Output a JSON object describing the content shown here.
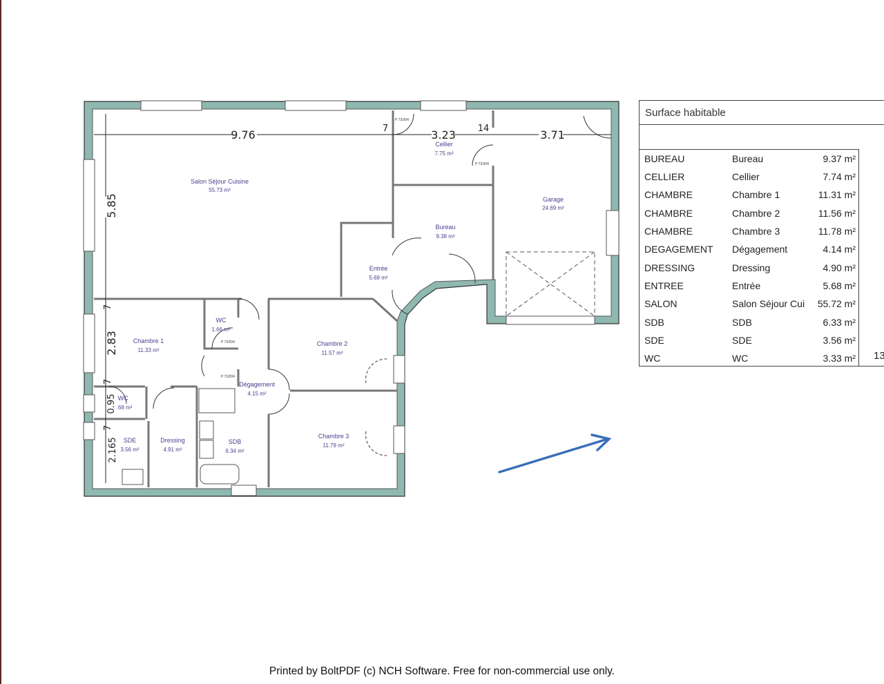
{
  "plan": {
    "rooms": [
      {
        "name": "Salon Séjour Cuisine",
        "area": "55.73 m²"
      },
      {
        "name": "Cellier",
        "area": "7.75 m²"
      },
      {
        "name": "Garage",
        "area": "24.69 m²"
      },
      {
        "name": "Bureau",
        "area": "9.38 m²"
      },
      {
        "name": "Entrée",
        "area": "5.69 m²"
      },
      {
        "name": "Chambre 1",
        "area": "11.33 m²"
      },
      {
        "name": "WC",
        "area": "1.66 m²"
      },
      {
        "name": "Chambre 2",
        "area": "11.57 m²"
      },
      {
        "name": "Dégagement",
        "area": "4.15 m²"
      },
      {
        "name": "Chambre 3",
        "area": "11.79 m²"
      },
      {
        "name": "WC",
        "area": ".68 m²"
      },
      {
        "name": "SDE",
        "area": "3.56 m²"
      },
      {
        "name": "Dressing",
        "area": "4.91 m²"
      },
      {
        "name": "SDB",
        "area": "6.34 m²"
      }
    ],
    "dimensions": {
      "salon_width": "9.76",
      "cellier_width": "3.23",
      "garage_width": "3.71",
      "wall_a": "7",
      "wall_b": "14",
      "salon_depth": "5.85",
      "chambre1_depth": "2.83",
      "wc_depth": "0.95",
      "sde_depth": "2.165",
      "wall_c": "7",
      "wall_d": "7",
      "wall_e": "7"
    },
    "door_ref": "P 73/204",
    "wall_color": "#8fb8b0",
    "label_color": "#4a3f8f",
    "arrow_color": "#3a6fb8"
  },
  "table": {
    "title": "Surface habitable",
    "rows": [
      {
        "category": "BUREAU",
        "room": "Bureau",
        "area": "9.37 m²"
      },
      {
        "category": "CELLIER",
        "room": "Cellier",
        "area": "7.74 m²"
      },
      {
        "category": "CHAMBRE",
        "room": "Chambre 1",
        "area": "11.31 m²"
      },
      {
        "category": "CHAMBRE",
        "room": "Chambre 2",
        "area": "11.56 m²"
      },
      {
        "category": "CHAMBRE",
        "room": "Chambre 3",
        "area": "11.78 m²"
      },
      {
        "category": "DEGAGEMENT",
        "room": "Dégagement",
        "area": "4.14 m²"
      },
      {
        "category": "DRESSING",
        "room": "Dressing",
        "area": "4.90 m²"
      },
      {
        "category": "ENTREE",
        "room": "Entrée",
        "area": "5.68 m²"
      },
      {
        "category": "SALON",
        "room": "Salon Séjour Cui",
        "area": "55.72 m²"
      },
      {
        "category": "SDB",
        "room": "SDB",
        "area": "6.33 m²"
      },
      {
        "category": "SDE",
        "room": "SDE",
        "area": "3.56 m²"
      },
      {
        "category": "WC",
        "room": "WC",
        "area": "3.33 m²"
      }
    ],
    "total_partial": "13"
  },
  "footer": "Printed by BoltPDF (c) NCH Software. Free for non-commercial use only."
}
